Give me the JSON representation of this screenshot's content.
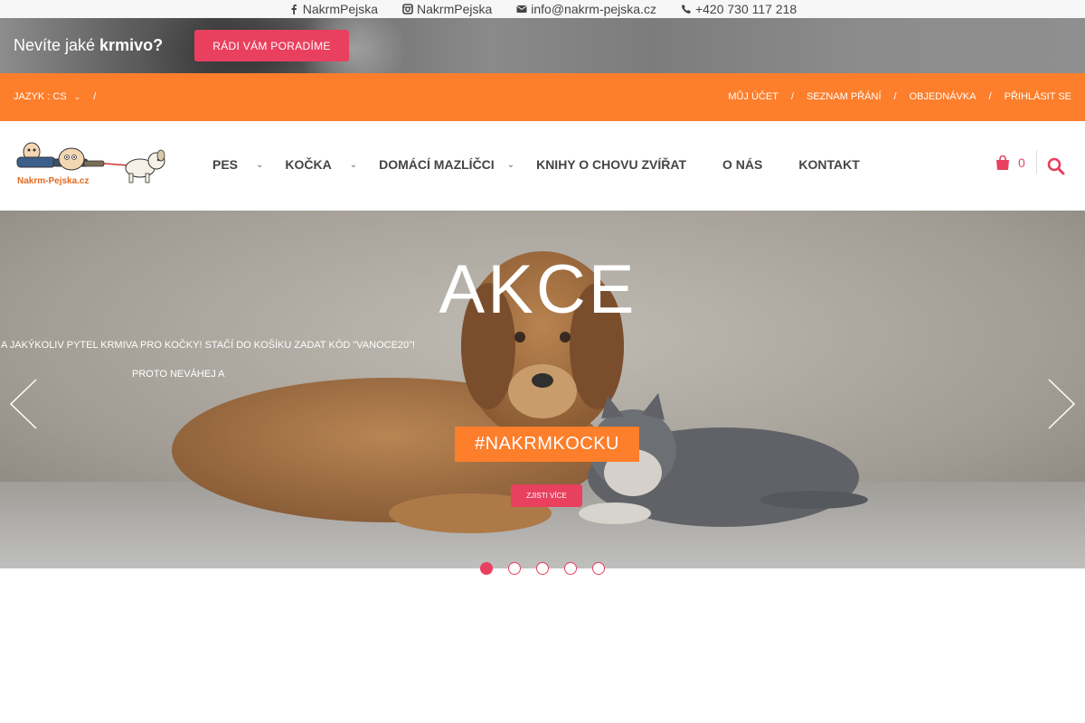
{
  "topbar": {
    "facebook": "NakrmPejska",
    "instagram": "NakrmPejska",
    "email": "info@nakrm-pejska.cz",
    "phone": "+420 730 117 218"
  },
  "promo": {
    "text_normal": "Nevíte jaké ",
    "text_bold": "krmivo?",
    "button": "RÁDI VÁM PORADÍME"
  },
  "utility": {
    "language_label": "JAZYK : CS",
    "separator": "/",
    "links": [
      "MŮJ ÚČET",
      "SEZNAM PŘÁNÍ",
      "OBJEDNÁVKA",
      "PŘIHLÁSIT SE"
    ]
  },
  "header": {
    "logo_text": "Nakrm-Pejska.cz",
    "nav": [
      {
        "label": "PES",
        "has_submenu": true
      },
      {
        "label": "KOČKA",
        "has_submenu": true
      },
      {
        "label": "DOMÁCÍ MAZLÍČCI",
        "has_submenu": true
      },
      {
        "label": "KNIHY O CHOVU ZVÍŘAT",
        "has_submenu": false
      },
      {
        "label": "O NÁS",
        "has_submenu": false
      },
      {
        "label": "KONTAKT",
        "has_submenu": false
      }
    ],
    "cart_count": "0"
  },
  "slider": {
    "title": "AKCE",
    "line1": "A JAKÝKOLIV PYTEL KRMIVA PRO KOČKY! STAČÍ DO KOŠÍKU ZADAT KÓD \"VANOCE20\"!",
    "line2": "PROTO NEVÁHEJ A",
    "tag": "#NAKRMKOCKU",
    "cta": "ZJISTI VÍCE",
    "slide_count": 5,
    "active_slide": 1
  },
  "colors": {
    "orange": "#fd7e2b",
    "pink": "#e8405e"
  }
}
